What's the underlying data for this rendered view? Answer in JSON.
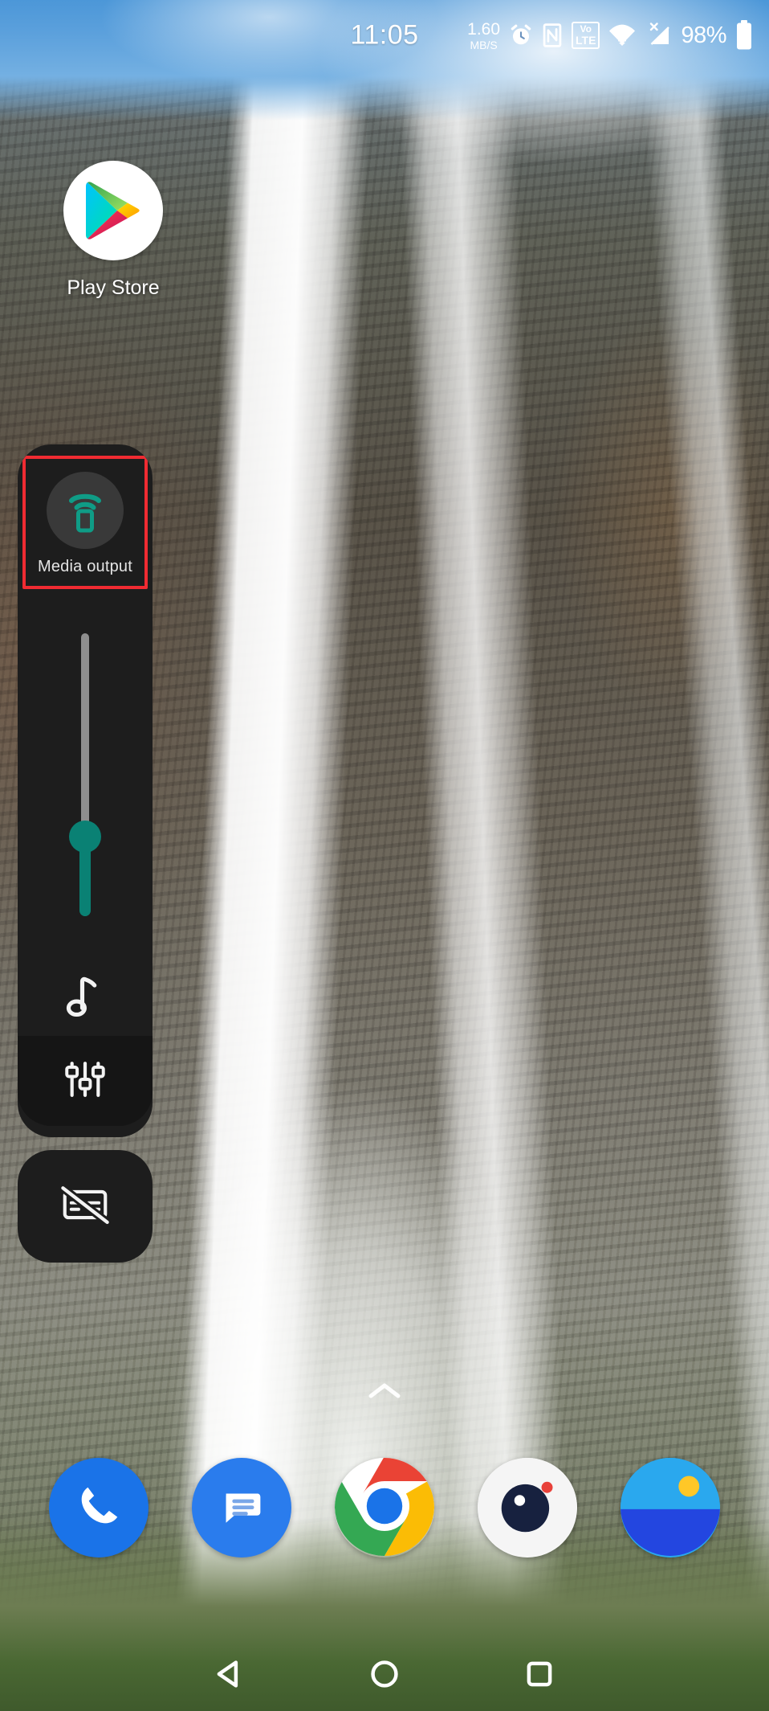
{
  "status_bar": {
    "time": "11:05",
    "network_speed_value": "1.60",
    "network_speed_unit": "MB/S",
    "alarm_icon": "alarm-clock-icon",
    "nfc_icon": "nfc-icon",
    "volte_top": "Vo",
    "volte_bottom": "LTE",
    "wifi_icon": "wifi-icon",
    "signal_icon": "cellular-signal-no-sim-icon",
    "battery_percent": "98%",
    "battery_icon": "battery-full-icon"
  },
  "home": {
    "app_shortcut": {
      "label": "Play Store",
      "icon": "play-store-icon"
    },
    "drawer_chevron_icon": "chevron-up-icon"
  },
  "volume_panel": {
    "media_output": {
      "label": "Media output",
      "icon": "cast-device-icon",
      "highlight_color": "#f02b32",
      "icon_color": "#0f9c86"
    },
    "slider": {
      "stream": "music",
      "stream_icon": "music-note-icon",
      "value_percent": 28,
      "track_color": "#8e8e8e",
      "fill_color": "#0a8174",
      "orientation": "vertical"
    },
    "settings_button": {
      "icon": "sound-settings-sliders-icon"
    },
    "captions_button": {
      "icon": "captions-off-icon"
    },
    "panel_color": "#1d1d1d"
  },
  "dock": {
    "items": [
      {
        "name": "phone",
        "icon": "phone-icon",
        "color": "#1a73e8"
      },
      {
        "name": "messages",
        "icon": "messages-icon",
        "color": "#2a7ced"
      },
      {
        "name": "chrome",
        "icon": "chrome-icon",
        "color": "#ffffff"
      },
      {
        "name": "camera",
        "icon": "camera-icon",
        "color": "#f7f7f7"
      },
      {
        "name": "gallery",
        "icon": "gallery-icon",
        "color": "#2aa8ee"
      }
    ]
  },
  "nav_bar": {
    "back_icon": "back-triangle-icon",
    "home_icon": "home-circle-icon",
    "recents_icon": "recents-square-icon"
  }
}
